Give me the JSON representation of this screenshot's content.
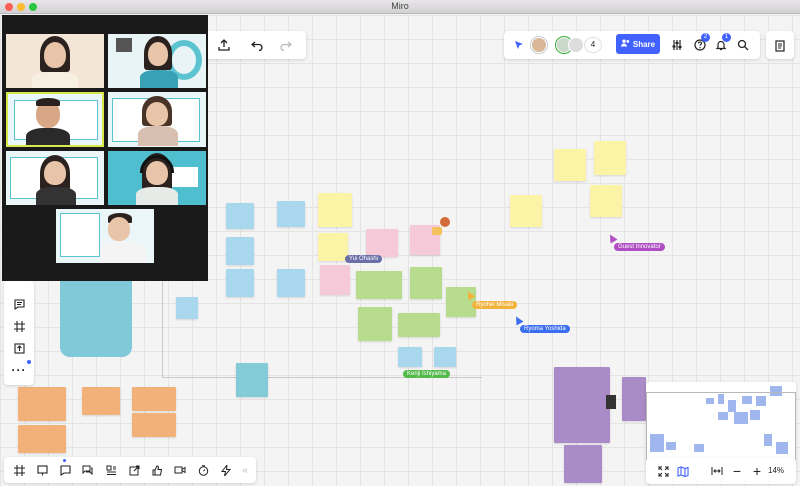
{
  "window": {
    "title": "Miro"
  },
  "toolbar": {
    "collaborator_count": "4",
    "share_label": "Share",
    "help_badge": "2",
    "notification_badge": "1",
    "zoom_level": "14%"
  },
  "cursors": [
    {
      "label": "Guest Innovator",
      "color": "#b04fc4"
    },
    {
      "label": "Ryoma Yoshida",
      "color": "#3b6df0"
    },
    {
      "label": "Ryohei Misaki",
      "color": "#f2b33d"
    },
    {
      "label": "Yui Ohashi",
      "color": "#6b6fa8"
    },
    {
      "label": "Kenji Ishiyama",
      "color": "#53b94a"
    }
  ],
  "colors": {
    "accent": "#4262ff",
    "badge": "#4262ff",
    "video_bg": "#1a1a1a"
  }
}
